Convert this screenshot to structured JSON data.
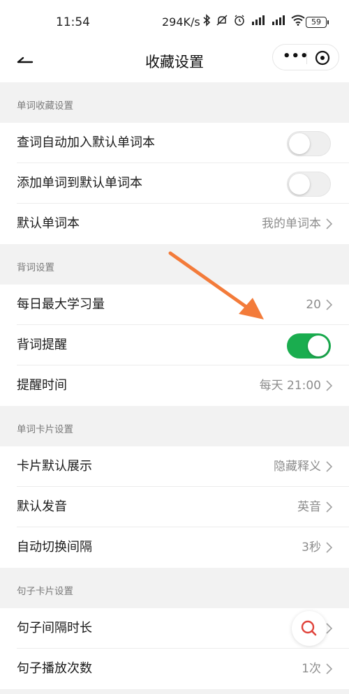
{
  "status_bar": {
    "time": "11:54",
    "net_speed": "294K/s",
    "battery": "59",
    "icons": [
      "bluetooth-icon",
      "mute-icon",
      "alarm-icon",
      "signal-icon",
      "signal-icon",
      "wifi-icon",
      "battery-icon"
    ]
  },
  "nav": {
    "title": "收藏设置",
    "more_label": "•••"
  },
  "sections": [
    {
      "header": "单词收藏设置",
      "rows": [
        {
          "label": "查词自动加入默认单词本",
          "toggle": false
        },
        {
          "label": "添加单词到默认单词本",
          "toggle": false
        },
        {
          "label": "默认单词本",
          "value": "我的单词本"
        }
      ]
    },
    {
      "header": "背词设置",
      "rows": [
        {
          "label": "每日最大学习量",
          "value": "20"
        },
        {
          "label": "背词提醒",
          "toggle": true
        },
        {
          "label": "提醒时间",
          "value": "每天 21:00"
        }
      ]
    },
    {
      "header": "单词卡片设置",
      "rows": [
        {
          "label": "卡片默认展示",
          "value": "隐藏释义"
        },
        {
          "label": "默认发音",
          "value": "英音"
        },
        {
          "label": "自动切换间隔",
          "value": "3秒"
        }
      ]
    },
    {
      "header": "句子卡片设置",
      "rows": [
        {
          "label": "句子间隔时长",
          "value": ""
        },
        {
          "label": "句子播放次数",
          "value": "1次"
        }
      ]
    }
  ],
  "colors": {
    "toggle_on": "#1aad4f",
    "annotation_arrow": "#f37b3a",
    "search_icon": "#e0433b"
  }
}
